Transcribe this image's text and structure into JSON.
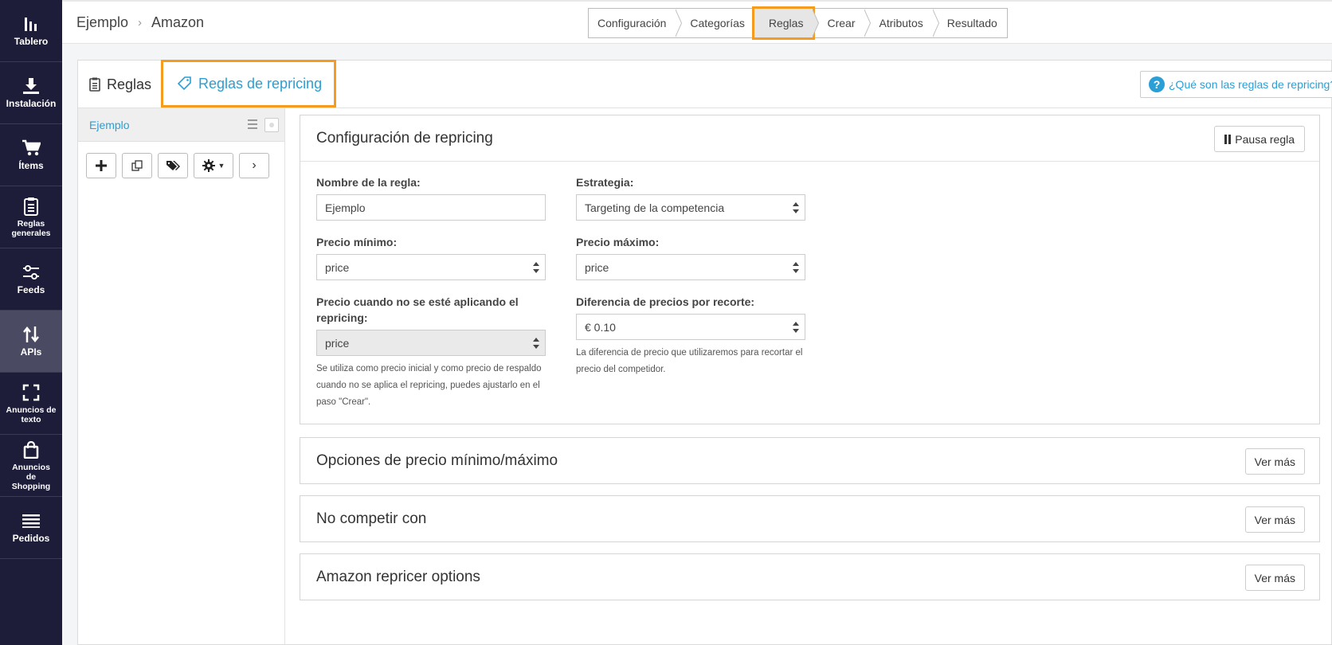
{
  "sidebar": {
    "items": [
      {
        "label": "Tablero",
        "icon": "bar-chart-icon"
      },
      {
        "label": "Instalación",
        "icon": "download-icon"
      },
      {
        "label": "Ítems",
        "icon": "cart-icon"
      },
      {
        "label": "Reglas generales",
        "icon": "clipboard-icon"
      },
      {
        "label": "Feeds",
        "icon": "sliders-icon"
      },
      {
        "label": "APIs",
        "icon": "up-down-arrows-icon"
      },
      {
        "label": "Anuncios de texto",
        "icon": "expand-icon"
      },
      {
        "label": "Anuncios de Shopping",
        "icon": "shopping-bag-icon"
      },
      {
        "label": "Pedidos",
        "icon": "list-icon"
      }
    ]
  },
  "breadcrumb": {
    "part1": "Ejemplo",
    "part2": "Amazon"
  },
  "steps": [
    "Configuración",
    "Categorías",
    "Reglas",
    "Crear",
    "Atributos",
    "Resultado"
  ],
  "tabs": {
    "reglas": "Reglas",
    "repricing": "Reglas de repricing"
  },
  "help_button": "¿Qué son las reglas de repricing?",
  "rules_list": {
    "items": [
      "Ejemplo"
    ]
  },
  "config": {
    "title": "Configuración de repricing",
    "pause_button": "Pausa regla",
    "nombre_label": "Nombre de la regla:",
    "nombre_value": "Ejemplo",
    "estrategia_label": "Estrategia:",
    "estrategia_value": "Targeting de la competencia",
    "precio_min_label": "Precio mínimo:",
    "precio_min_value": "price",
    "precio_max_label": "Precio máximo:",
    "precio_max_value": "price",
    "precio_no_rep_label": "Precio cuando no se esté aplicando el repricing:",
    "precio_no_rep_value": "price",
    "precio_no_rep_help": "Se utiliza como precio inicial y como precio de respaldo cuando no se aplica el repricing, puedes ajustarlo en el paso \"Crear\".",
    "diferencia_label": "Diferencia de precios por recorte:",
    "diferencia_value": "€ 0.10",
    "diferencia_help": "La diferencia de precio que utilizaremos para recortar el precio del competidor."
  },
  "sections": [
    {
      "title": "Opciones de precio mínimo/máximo",
      "button": "Ver más"
    },
    {
      "title": "No competir con",
      "button": "Ver más"
    },
    {
      "title": "Amazon repricer options",
      "button": "Ver más"
    }
  ],
  "colors": {
    "accent": "#2a9fd6",
    "highlight": "#f59b1f",
    "sidebar": "#1d1d3a"
  }
}
